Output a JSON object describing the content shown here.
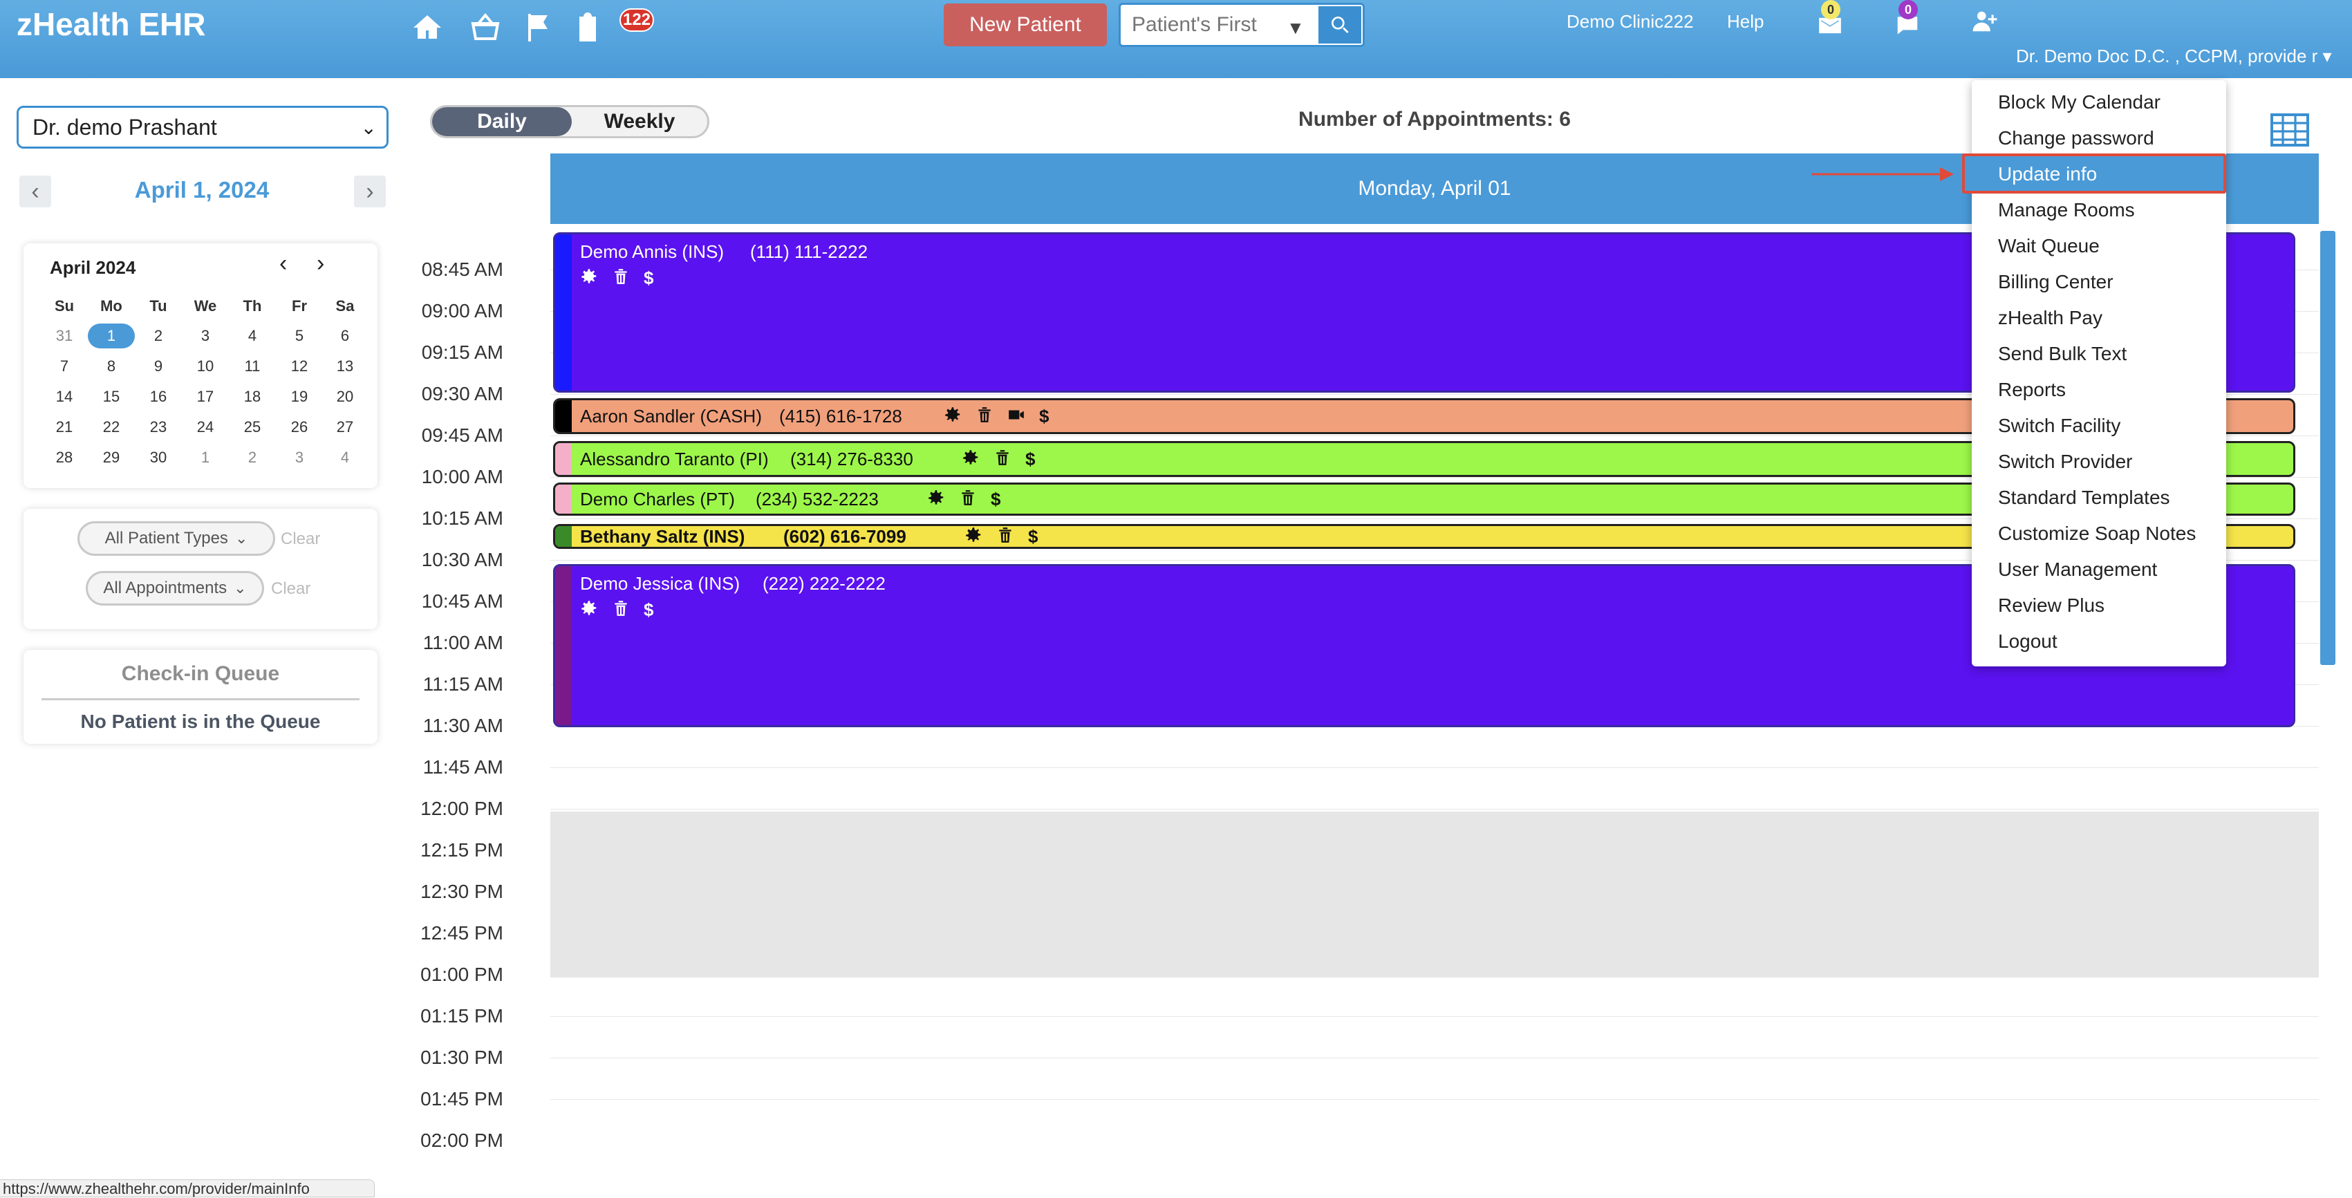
{
  "app": {
    "brand": "zHealth EHR"
  },
  "header": {
    "queue_badge": "122",
    "new_patient_label": "New Patient",
    "search_placeholder": "Patient's First",
    "clinic": "Demo Clinic222",
    "help": "Help",
    "mail_count": "0",
    "chat_count": "0",
    "provider": "Dr. Demo Doc D.C. , CCPM, provide r ▾"
  },
  "sidebar": {
    "provider_select": "Dr. demo Prashant",
    "current_date": "April 1, 2024",
    "calendar": {
      "month": "April 2024",
      "weekdays": [
        "Su",
        "Mo",
        "Tu",
        "We",
        "Th",
        "Fr",
        "Sa"
      ],
      "weeks": [
        [
          "31",
          "1",
          "2",
          "3",
          "4",
          "5",
          "6"
        ],
        [
          "7",
          "8",
          "9",
          "10",
          "11",
          "12",
          "13"
        ],
        [
          "14",
          "15",
          "16",
          "17",
          "18",
          "19",
          "20"
        ],
        [
          "21",
          "22",
          "23",
          "24",
          "25",
          "26",
          "27"
        ],
        [
          "28",
          "29",
          "30",
          "1",
          "2",
          "3",
          "4"
        ]
      ]
    },
    "filters": {
      "patient_types": "All Patient Types",
      "appointments": "All Appointments",
      "clear": "Clear"
    },
    "queue": {
      "title": "Check-in Queue",
      "empty": "No Patient is in the Queue"
    }
  },
  "main": {
    "view_daily": "Daily",
    "view_weekly": "Weekly",
    "appointment_count": "Number of Appointments: 6",
    "day_header": "Monday, April 01",
    "times": [
      "08:45 AM",
      "09:00 AM",
      "09:15 AM",
      "09:30 AM",
      "09:45 AM",
      "10:00 AM",
      "10:15 AM",
      "10:30 AM",
      "10:45 AM",
      "11:00 AM",
      "11:15 AM",
      "11:30 AM",
      "11:45 AM",
      "12:00 PM",
      "12:15 PM",
      "12:30 PM",
      "12:45 PM",
      "01:00 PM",
      "01:15 PM",
      "01:30 PM",
      "01:45 PM",
      "02:00 PM"
    ],
    "appointments": [
      {
        "name": "Demo Annis (INS)",
        "phone": "(111) 111-2222",
        "color": "#5b12f0",
        "stripe": "#1a1aff"
      },
      {
        "name": "Aaron Sandler (CASH)",
        "phone": "(415) 616-1728",
        "color": "#f1a07c",
        "stripe": "#000000"
      },
      {
        "name": "Alessandro Taranto (PI)",
        "phone": "(314) 276-8330",
        "color": "#9df74a",
        "stripe": "#f4b0c8"
      },
      {
        "name": "Demo Charles (PT)",
        "phone": "(234) 532-2223",
        "color": "#9df74a",
        "stripe": "#f4b0c8"
      },
      {
        "name": "Bethany Saltz (INS)",
        "phone": "(602) 616-7099",
        "color": "#f5e34a",
        "stripe": "#3a8a2a"
      },
      {
        "name": "Demo Jessica (INS)",
        "phone": "(222) 222-2222",
        "color": "#5b12f0",
        "stripe": "#7a1a8a"
      }
    ]
  },
  "user_menu": {
    "items": [
      "Block My Calendar",
      "Change password",
      "Update info",
      "Manage Rooms",
      "Wait Queue",
      "Billing Center",
      "zHealth Pay",
      "Send Bulk Text",
      "Reports",
      "Switch Facility",
      "Switch Provider",
      "Standard Templates",
      "Customize Soap Notes",
      "User Management",
      "Review Plus",
      "Logout"
    ]
  },
  "status_bar": {
    "url": "https://www.zhealthehr.com/provider/mainInfo"
  },
  "colors": {
    "header_blue": "#4a9ad8",
    "accent_red": "#e04a3a"
  }
}
